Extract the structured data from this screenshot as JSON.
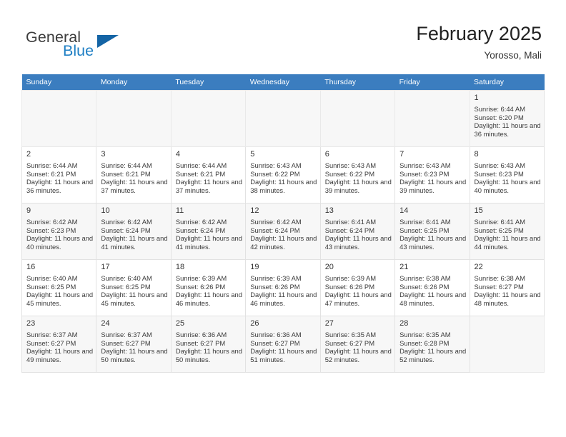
{
  "brand": {
    "name_part1": "General",
    "name_part2": "Blue",
    "logo_icon": "triangle-logo-icon"
  },
  "header": {
    "title": "February 2025",
    "subtitle": "Yorosso, Mali"
  },
  "calendar": {
    "weekday_headers": [
      "Sunday",
      "Monday",
      "Tuesday",
      "Wednesday",
      "Thursday",
      "Friday",
      "Saturday"
    ],
    "header_color": "#3b7dbf",
    "accent_color": "#1464a5",
    "weeks": [
      [
        {
          "day": "",
          "empty": true
        },
        {
          "day": "",
          "empty": true
        },
        {
          "day": "",
          "empty": true
        },
        {
          "day": "",
          "empty": true
        },
        {
          "day": "",
          "empty": true
        },
        {
          "day": "",
          "empty": true
        },
        {
          "day": "1",
          "sunrise": "Sunrise: 6:44 AM",
          "sunset": "Sunset: 6:20 PM",
          "daylight": "Daylight: 11 hours and 36 minutes."
        }
      ],
      [
        {
          "day": "2",
          "sunrise": "Sunrise: 6:44 AM",
          "sunset": "Sunset: 6:21 PM",
          "daylight": "Daylight: 11 hours and 36 minutes."
        },
        {
          "day": "3",
          "sunrise": "Sunrise: 6:44 AM",
          "sunset": "Sunset: 6:21 PM",
          "daylight": "Daylight: 11 hours and 37 minutes."
        },
        {
          "day": "4",
          "sunrise": "Sunrise: 6:44 AM",
          "sunset": "Sunset: 6:21 PM",
          "daylight": "Daylight: 11 hours and 37 minutes."
        },
        {
          "day": "5",
          "sunrise": "Sunrise: 6:43 AM",
          "sunset": "Sunset: 6:22 PM",
          "daylight": "Daylight: 11 hours and 38 minutes."
        },
        {
          "day": "6",
          "sunrise": "Sunrise: 6:43 AM",
          "sunset": "Sunset: 6:22 PM",
          "daylight": "Daylight: 11 hours and 39 minutes."
        },
        {
          "day": "7",
          "sunrise": "Sunrise: 6:43 AM",
          "sunset": "Sunset: 6:23 PM",
          "daylight": "Daylight: 11 hours and 39 minutes."
        },
        {
          "day": "8",
          "sunrise": "Sunrise: 6:43 AM",
          "sunset": "Sunset: 6:23 PM",
          "daylight": "Daylight: 11 hours and 40 minutes."
        }
      ],
      [
        {
          "day": "9",
          "sunrise": "Sunrise: 6:42 AM",
          "sunset": "Sunset: 6:23 PM",
          "daylight": "Daylight: 11 hours and 40 minutes."
        },
        {
          "day": "10",
          "sunrise": "Sunrise: 6:42 AM",
          "sunset": "Sunset: 6:24 PM",
          "daylight": "Daylight: 11 hours and 41 minutes."
        },
        {
          "day": "11",
          "sunrise": "Sunrise: 6:42 AM",
          "sunset": "Sunset: 6:24 PM",
          "daylight": "Daylight: 11 hours and 41 minutes."
        },
        {
          "day": "12",
          "sunrise": "Sunrise: 6:42 AM",
          "sunset": "Sunset: 6:24 PM",
          "daylight": "Daylight: 11 hours and 42 minutes."
        },
        {
          "day": "13",
          "sunrise": "Sunrise: 6:41 AM",
          "sunset": "Sunset: 6:24 PM",
          "daylight": "Daylight: 11 hours and 43 minutes."
        },
        {
          "day": "14",
          "sunrise": "Sunrise: 6:41 AM",
          "sunset": "Sunset: 6:25 PM",
          "daylight": "Daylight: 11 hours and 43 minutes."
        },
        {
          "day": "15",
          "sunrise": "Sunrise: 6:41 AM",
          "sunset": "Sunset: 6:25 PM",
          "daylight": "Daylight: 11 hours and 44 minutes."
        }
      ],
      [
        {
          "day": "16",
          "sunrise": "Sunrise: 6:40 AM",
          "sunset": "Sunset: 6:25 PM",
          "daylight": "Daylight: 11 hours and 45 minutes."
        },
        {
          "day": "17",
          "sunrise": "Sunrise: 6:40 AM",
          "sunset": "Sunset: 6:25 PM",
          "daylight": "Daylight: 11 hours and 45 minutes."
        },
        {
          "day": "18",
          "sunrise": "Sunrise: 6:39 AM",
          "sunset": "Sunset: 6:26 PM",
          "daylight": "Daylight: 11 hours and 46 minutes."
        },
        {
          "day": "19",
          "sunrise": "Sunrise: 6:39 AM",
          "sunset": "Sunset: 6:26 PM",
          "daylight": "Daylight: 11 hours and 46 minutes."
        },
        {
          "day": "20",
          "sunrise": "Sunrise: 6:39 AM",
          "sunset": "Sunset: 6:26 PM",
          "daylight": "Daylight: 11 hours and 47 minutes."
        },
        {
          "day": "21",
          "sunrise": "Sunrise: 6:38 AM",
          "sunset": "Sunset: 6:26 PM",
          "daylight": "Daylight: 11 hours and 48 minutes."
        },
        {
          "day": "22",
          "sunrise": "Sunrise: 6:38 AM",
          "sunset": "Sunset: 6:27 PM",
          "daylight": "Daylight: 11 hours and 48 minutes."
        }
      ],
      [
        {
          "day": "23",
          "sunrise": "Sunrise: 6:37 AM",
          "sunset": "Sunset: 6:27 PM",
          "daylight": "Daylight: 11 hours and 49 minutes."
        },
        {
          "day": "24",
          "sunrise": "Sunrise: 6:37 AM",
          "sunset": "Sunset: 6:27 PM",
          "daylight": "Daylight: 11 hours and 50 minutes."
        },
        {
          "day": "25",
          "sunrise": "Sunrise: 6:36 AM",
          "sunset": "Sunset: 6:27 PM",
          "daylight": "Daylight: 11 hours and 50 minutes."
        },
        {
          "day": "26",
          "sunrise": "Sunrise: 6:36 AM",
          "sunset": "Sunset: 6:27 PM",
          "daylight": "Daylight: 11 hours and 51 minutes."
        },
        {
          "day": "27",
          "sunrise": "Sunrise: 6:35 AM",
          "sunset": "Sunset: 6:27 PM",
          "daylight": "Daylight: 11 hours and 52 minutes."
        },
        {
          "day": "28",
          "sunrise": "Sunrise: 6:35 AM",
          "sunset": "Sunset: 6:28 PM",
          "daylight": "Daylight: 11 hours and 52 minutes."
        },
        {
          "day": "",
          "empty": true
        }
      ]
    ]
  }
}
